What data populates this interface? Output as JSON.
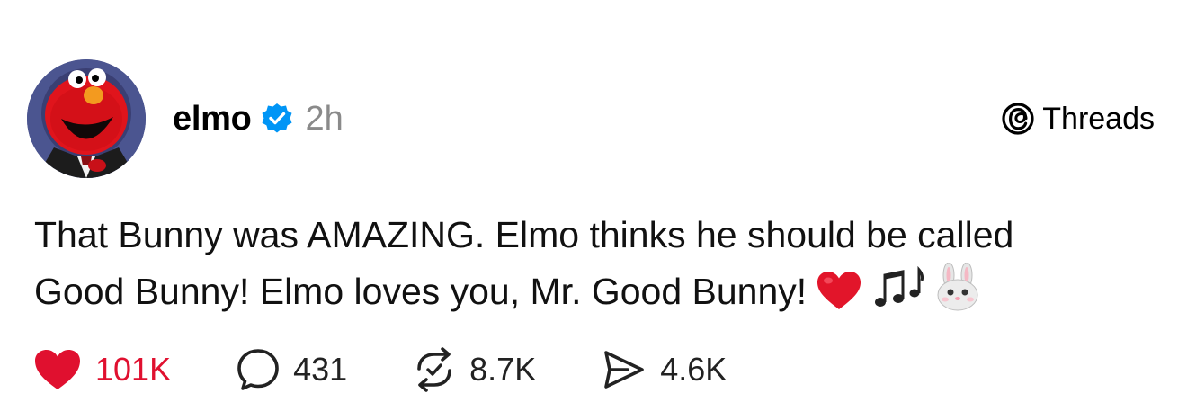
{
  "post": {
    "username": "elmo",
    "timestamp": "2h",
    "platform_label": "Threads",
    "text_line1": "That Bunny was AMAZING. Elmo thinks he should be called",
    "text_line2": "Good Bunny! Elmo loves you, Mr. Good Bunny!",
    "emojis": [
      "red-heart",
      "musical-notes",
      "rabbit-face"
    ]
  },
  "actions": {
    "likes": "101K",
    "replies": "431",
    "reposts": "8.7K",
    "shares": "4.6K"
  },
  "icons": {
    "verified": "verified-badge-icon",
    "threads": "threads-logo-icon",
    "like": "heart-icon",
    "reply": "comment-bubble-icon",
    "repost": "repost-icon",
    "share": "send-icon"
  },
  "colors": {
    "verified": "#0095f6",
    "like": "#e0102f",
    "timestamp": "#8a8a8a"
  }
}
